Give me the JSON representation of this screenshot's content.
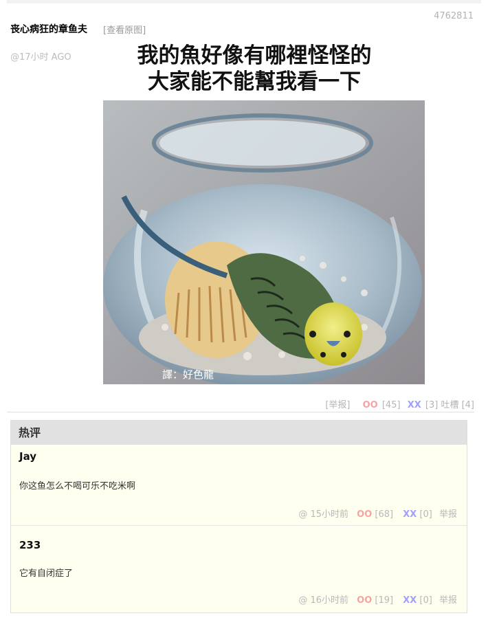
{
  "post": {
    "id": "4762811",
    "author": "丧心病狂的章鱼夫",
    "time": "@17小时 AGO",
    "view_original": "[查看原图]",
    "meme_caption_line1": "我的魚好像有哪裡怪怪的",
    "meme_caption_line2": "大家能不能幫我看一下",
    "meme_watermark": "譯：好色龍",
    "report": "[举报]",
    "oo_label": "OO",
    "oo_count": "[45]",
    "xx_label": "XX",
    "xx_count": "[3]",
    "tucao": "吐槽 [4]"
  },
  "hot_comments": {
    "title": "热评",
    "items": [
      {
        "author": "Jay",
        "text": "你这鱼怎么不喝可乐不吃米啊",
        "at": "@",
        "time": "15小时前",
        "oo_label": "OO",
        "oo_count": "[68]",
        "xx_label": "XX",
        "xx_count": "[0]",
        "report": "举报"
      },
      {
        "author": "233",
        "text": "它有自闭症了",
        "at": "@",
        "time": "16小时前",
        "oo_label": "OO",
        "oo_count": "[19]",
        "xx_label": "XX",
        "xx_count": "[0]",
        "report": "举报"
      }
    ]
  },
  "colors": {
    "oo": "#f7a3a3",
    "xx": "#9fa0ff",
    "hot_header_bg": "#e1e1e1",
    "comment_bg": "#fffff0"
  },
  "icons": {
    "meme_subject": "budgie-in-fishbowl-photo"
  }
}
